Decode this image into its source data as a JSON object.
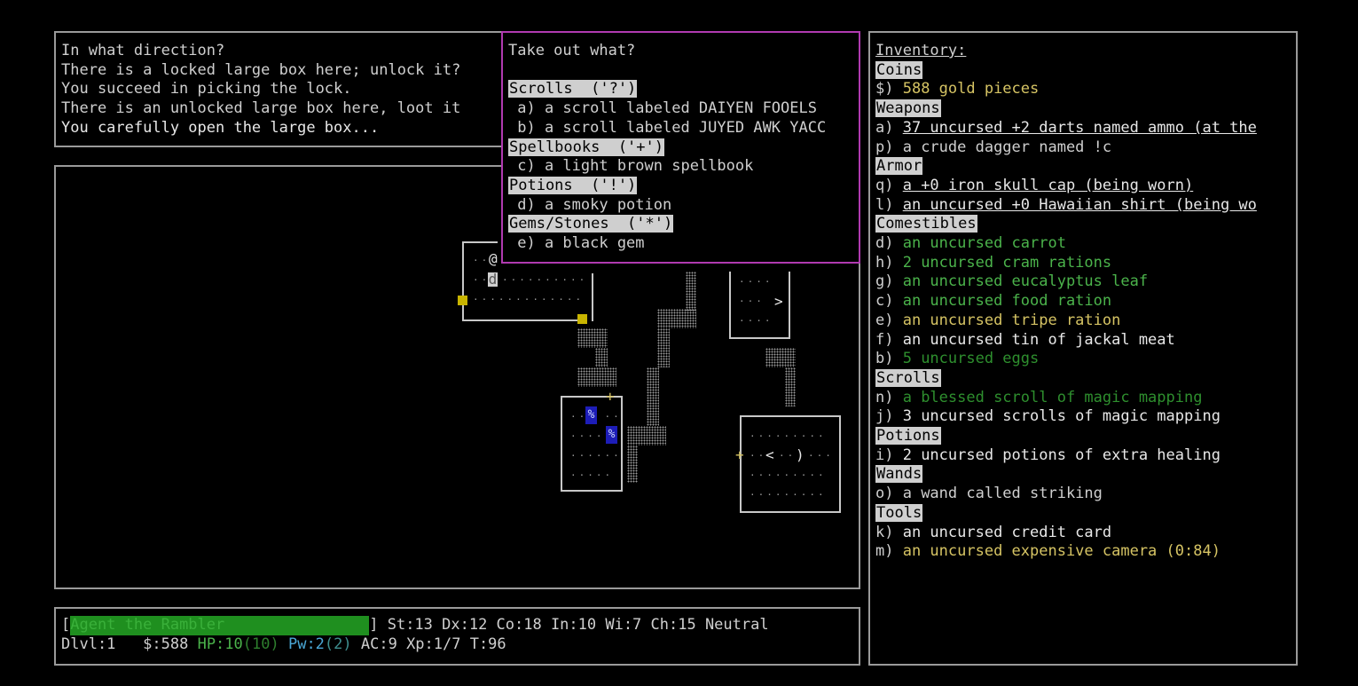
{
  "messages": [
    "In what direction?",
    "There is a locked large box here; unlock it?",
    "You succeed in picking the lock.",
    "There is an unlocked large box here, loot it",
    "You carefully open the large box..."
  ],
  "menu": {
    "title": "Take out what?",
    "sections": [
      {
        "header": "Scrolls  ('?')",
        "items": [
          " a) a scroll labeled DAIYEN FOOELS",
          " b) a scroll labeled JUYED AWK YACC"
        ]
      },
      {
        "header": "Spellbooks  ('+')",
        "items": [
          " c) a light brown spellbook"
        ]
      },
      {
        "header": "Potions  ('!')",
        "items": [
          " d) a smoky potion"
        ]
      },
      {
        "header": "Gems/Stones  ('*')",
        "items": [
          " e) a black gem"
        ]
      }
    ]
  },
  "inventory": {
    "title": "Inventory:",
    "rows": [
      {
        "type": "header",
        "text": "Coins"
      },
      {
        "type": "item",
        "letter": "$) ",
        "text": "588 gold pieces",
        "color": "yellow",
        "ul": false
      },
      {
        "type": "header",
        "text": "Weapons"
      },
      {
        "type": "item",
        "letter": "a) ",
        "text": "37 uncursed +2 darts named ammo (at the",
        "color": "white",
        "ul": true
      },
      {
        "type": "item",
        "letter": "p) ",
        "text": "a crude dagger named !c",
        "color": "gray",
        "ul": false
      },
      {
        "type": "header",
        "text": "Armor"
      },
      {
        "type": "item",
        "letter": "q) ",
        "text": "a +0 iron skull cap (being worn)",
        "color": "white",
        "ul": true
      },
      {
        "type": "item",
        "letter": "l) ",
        "text": "an uncursed +0 Hawaiian shirt (being wo",
        "color": "white",
        "ul": true
      },
      {
        "type": "header",
        "text": "Comestibles"
      },
      {
        "type": "item",
        "letter": "d) ",
        "text": "an uncursed carrot",
        "color": "green",
        "ul": false
      },
      {
        "type": "item",
        "letter": "h) ",
        "text": "2 uncursed cram rations",
        "color": "green",
        "ul": false
      },
      {
        "type": "item",
        "letter": "g) ",
        "text": "an uncursed eucalyptus leaf",
        "color": "green",
        "ul": false
      },
      {
        "type": "item",
        "letter": "c) ",
        "text": "an uncursed food ration",
        "color": "green",
        "ul": false
      },
      {
        "type": "item",
        "letter": "e) ",
        "text": "an uncursed tripe ration",
        "color": "yellow",
        "ul": false
      },
      {
        "type": "item",
        "letter": "f) ",
        "text": "an uncursed tin of jackal meat",
        "color": "white",
        "ul": false
      },
      {
        "type": "item",
        "letter": "b) ",
        "text": "5 uncursed eggs",
        "color": "dgreen",
        "ul": false
      },
      {
        "type": "header",
        "text": "Scrolls"
      },
      {
        "type": "item",
        "letter": "n) ",
        "text": "a blessed scroll of magic mapping",
        "color": "dgreen",
        "ul": false
      },
      {
        "type": "item",
        "letter": "j) ",
        "text": "3 uncursed scrolls of magic mapping",
        "color": "white",
        "ul": false
      },
      {
        "type": "header",
        "text": "Potions"
      },
      {
        "type": "item",
        "letter": "i) ",
        "text": "2 uncursed potions of extra healing",
        "color": "white",
        "ul": false
      },
      {
        "type": "header",
        "text": "Wands"
      },
      {
        "type": "item",
        "letter": "o) ",
        "text": "a wand called striking",
        "color": "gray",
        "ul": false
      },
      {
        "type": "header",
        "text": "Tools"
      },
      {
        "type": "item",
        "letter": "k) ",
        "text": "an uncursed credit card",
        "color": "white",
        "ul": false
      },
      {
        "type": "item",
        "letter": "m) ",
        "text": "an uncursed expensive camera (0:84)",
        "color": "yellow",
        "ul": false
      }
    ]
  },
  "status": {
    "name": "Agent the Rambler",
    "line1_rest": "] St:13 Dx:12 Co:18 In:10 Wi:7 Ch:15 Neutral",
    "dlvl": "Dlvl:1",
    "gold": "$:588",
    "hp_label": "HP:10",
    "hp_max": "(10)",
    "pw_label": "Pw:2",
    "pw_max": "(2)",
    "rest": "AC:9 Xp:1/7 T:96"
  },
  "map": {
    "player": "@",
    "pet": "d",
    "stairs_down": ">",
    "stairs_up": "<",
    "food": "%",
    "weapon": ")",
    "spellbook": "+"
  },
  "colors": {
    "bg": "#000000",
    "border": "#9a9a9a",
    "menu_border": "#b03ab0",
    "hp": "#4bb34b",
    "pw": "#4aa7d6",
    "name_bar": "#1f8f1f",
    "door": "#c8b400"
  }
}
